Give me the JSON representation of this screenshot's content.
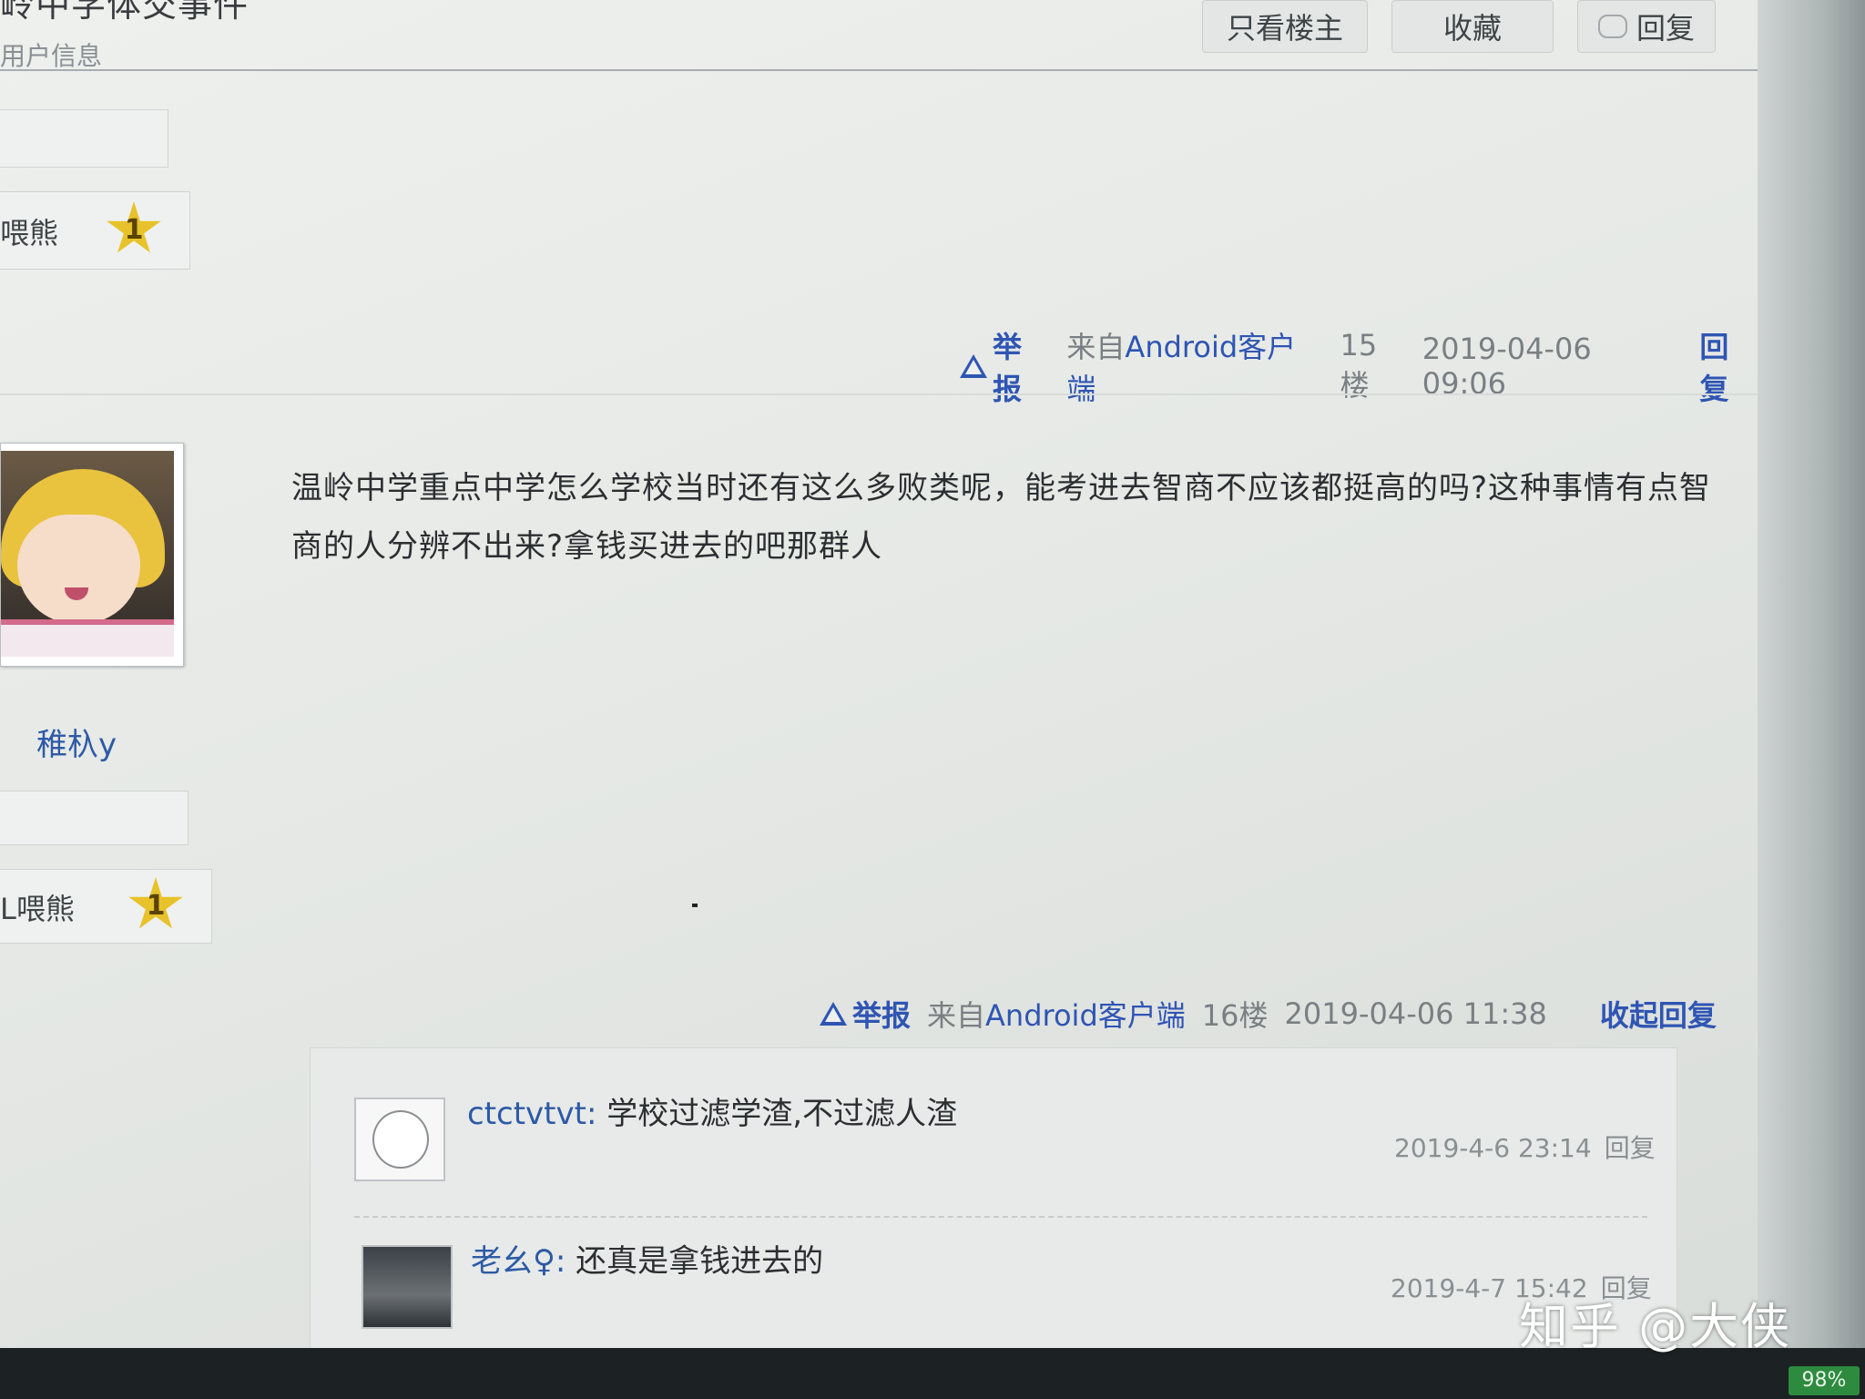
{
  "header": {
    "title": "岭中学体交事件",
    "subtitle": "用户信息",
    "buttons": {
      "only_op": "只看楼主",
      "favorite": "收藏",
      "reply": "回复"
    }
  },
  "sidebar_top": {
    "badge_name": "喂熊",
    "badge_level": "1"
  },
  "post_15": {
    "report": "举报",
    "client": "来自Android客户端",
    "floor": "15楼",
    "time": "2019-04-06 09:06",
    "reply": "回复"
  },
  "post_16": {
    "username": "稚杁y",
    "badge_name": "L喂熊",
    "badge_level": "1",
    "content": "温岭中学重点中学怎么学校当时还有这么多败类呢，能考进去智商不应该都挺高的吗?这种事情有点智商的人分辨不出来?拿钱买进去的吧那群人",
    "report": "举报",
    "client": "来自Android客户端",
    "floor": "16楼",
    "time": "2019-04-06 11:38",
    "collapse": "收起回复"
  },
  "replies": [
    {
      "user": "ctctvtvt:",
      "text": " 学校过滤学渣,不过滤人渣",
      "time": "2019-4-6 23:14",
      "reply": "回复"
    },
    {
      "user": "老幺♀:",
      "text": " 还真是拿钱进去的",
      "time": "2019-4-7 15:42",
      "reply": "回复"
    }
  ],
  "watermark": "知乎 @大侠",
  "battery": "98%"
}
